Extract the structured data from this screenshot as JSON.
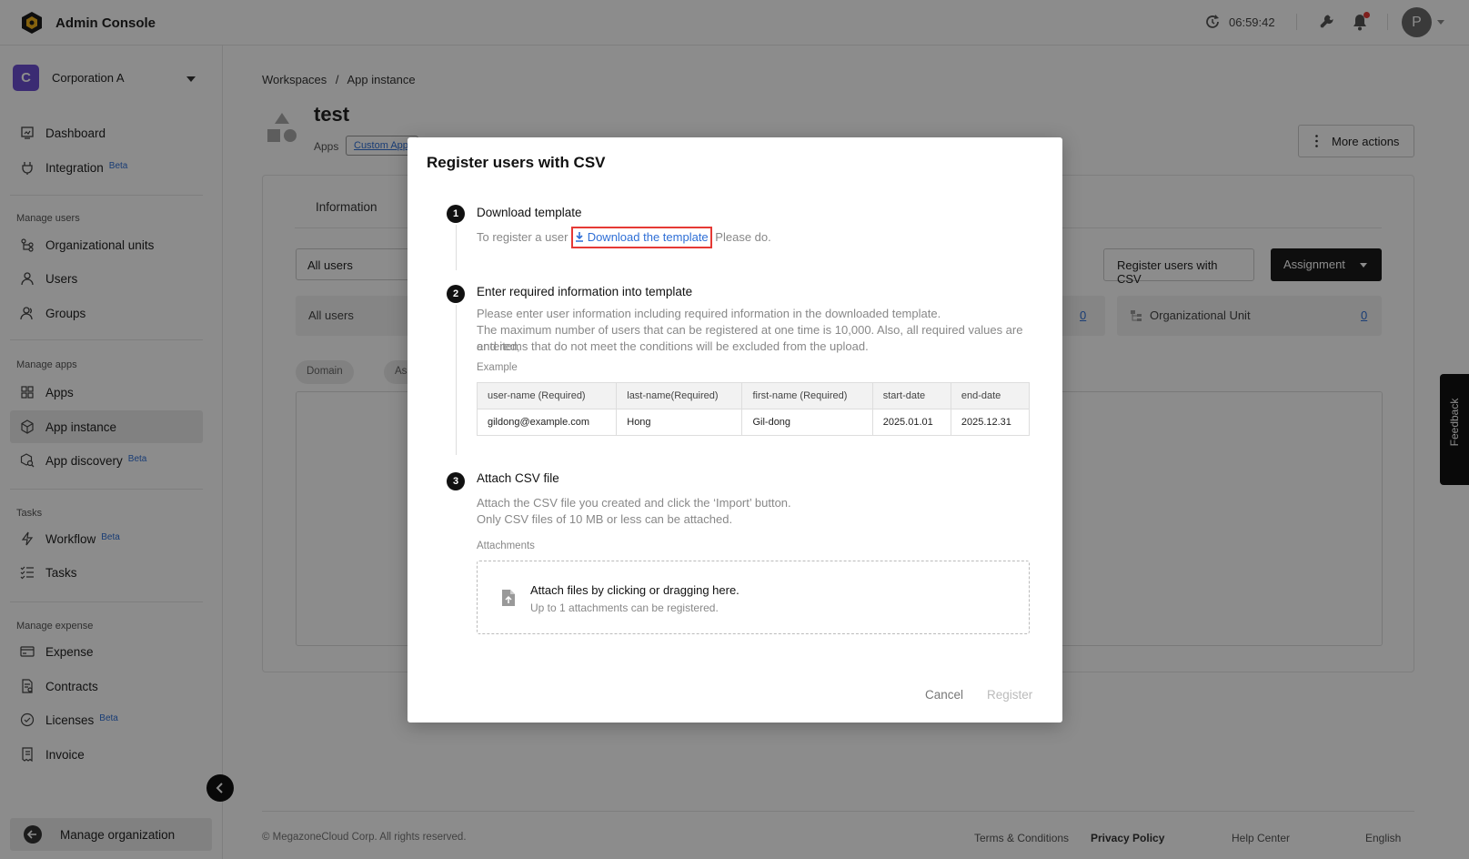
{
  "topbar": {
    "app_title": "Admin Console",
    "clock": "06:59:42",
    "avatar_initial": "P"
  },
  "sidebar": {
    "org_initial": "C",
    "org_name": "Corporation A",
    "top_items": [
      {
        "label": "Dashboard"
      },
      {
        "label": "Integration",
        "badge": "Beta"
      }
    ],
    "groups": [
      {
        "title": "Manage users",
        "items": [
          {
            "label": "Organizational units"
          },
          {
            "label": "Users"
          },
          {
            "label": "Groups"
          }
        ]
      },
      {
        "title": "Manage apps",
        "items": [
          {
            "label": "Apps"
          },
          {
            "label": "App instance"
          },
          {
            "label": "App discovery",
            "badge": "Beta"
          }
        ]
      },
      {
        "title": "Tasks",
        "items": [
          {
            "label": "Workflow",
            "badge": "Beta"
          },
          {
            "label": "Tasks"
          }
        ]
      },
      {
        "title": "Manage expense",
        "items": [
          {
            "label": "Expense"
          },
          {
            "label": "Contracts"
          },
          {
            "label": "Licenses",
            "badge": "Beta"
          },
          {
            "label": "Invoice"
          }
        ]
      }
    ],
    "active_item": "App instance",
    "manage_org": "Manage organization"
  },
  "main": {
    "breadcrumb": [
      "Workspaces",
      "/",
      "App instance"
    ],
    "title": "test",
    "apps_label": "Apps",
    "custom_app_tag": "Custom App",
    "more_actions": "More actions",
    "tab_information": "Information",
    "filter_all_users": "All users",
    "register_csv_button": "Register users with CSV",
    "assignment_button": "Assignment",
    "stats": {
      "all_users_label": "All users",
      "all_users_value": "0",
      "org_unit_label": "Organizational Unit",
      "org_unit_value": "0"
    },
    "chips": [
      "Domain",
      "Ass"
    ]
  },
  "footer": {
    "copyright": "© MegazoneCloud Corp. All rights reserved.",
    "terms": "Terms & Conditions",
    "privacy": "Privacy Policy",
    "help": "Help Center",
    "language": "English"
  },
  "feedback": "Feedback",
  "modal": {
    "title": "Register users with CSV",
    "step1": {
      "num": "1",
      "title": "Download template",
      "text_before": "To register a user",
      "link": "Download the template",
      "text_after": "Please do."
    },
    "step2": {
      "num": "2",
      "title": "Enter required information into template",
      "line1": "Please enter user information including required information in the downloaded template.",
      "line2": "The maximum number of users that can be registered at one time is 10,000. Also, all required values are entered,",
      "line3": "and items that do not meet the conditions will be excluded from the upload.",
      "example_label": "Example",
      "table_headers": [
        "user-name (Required)",
        "last-name(Required)",
        "first-name (Required)",
        "start-date",
        "end-date"
      ],
      "table_row": [
        "gildong@example.com",
        "Hong",
        "Gil-dong",
        "2025.01.01",
        "2025.12.31"
      ]
    },
    "step3": {
      "num": "3",
      "title": "Attach CSV file",
      "line1": "Attach the CSV file you created and click the ‘Import’ button.",
      "line2": "Only CSV files of 10 MB or less can be attached.",
      "attach_label": "Attachments",
      "dropzone_main": "Attach files by clicking or dragging here.",
      "dropzone_sub": "Up to 1 attachments can be registered."
    },
    "cancel": "Cancel",
    "register": "Register"
  }
}
